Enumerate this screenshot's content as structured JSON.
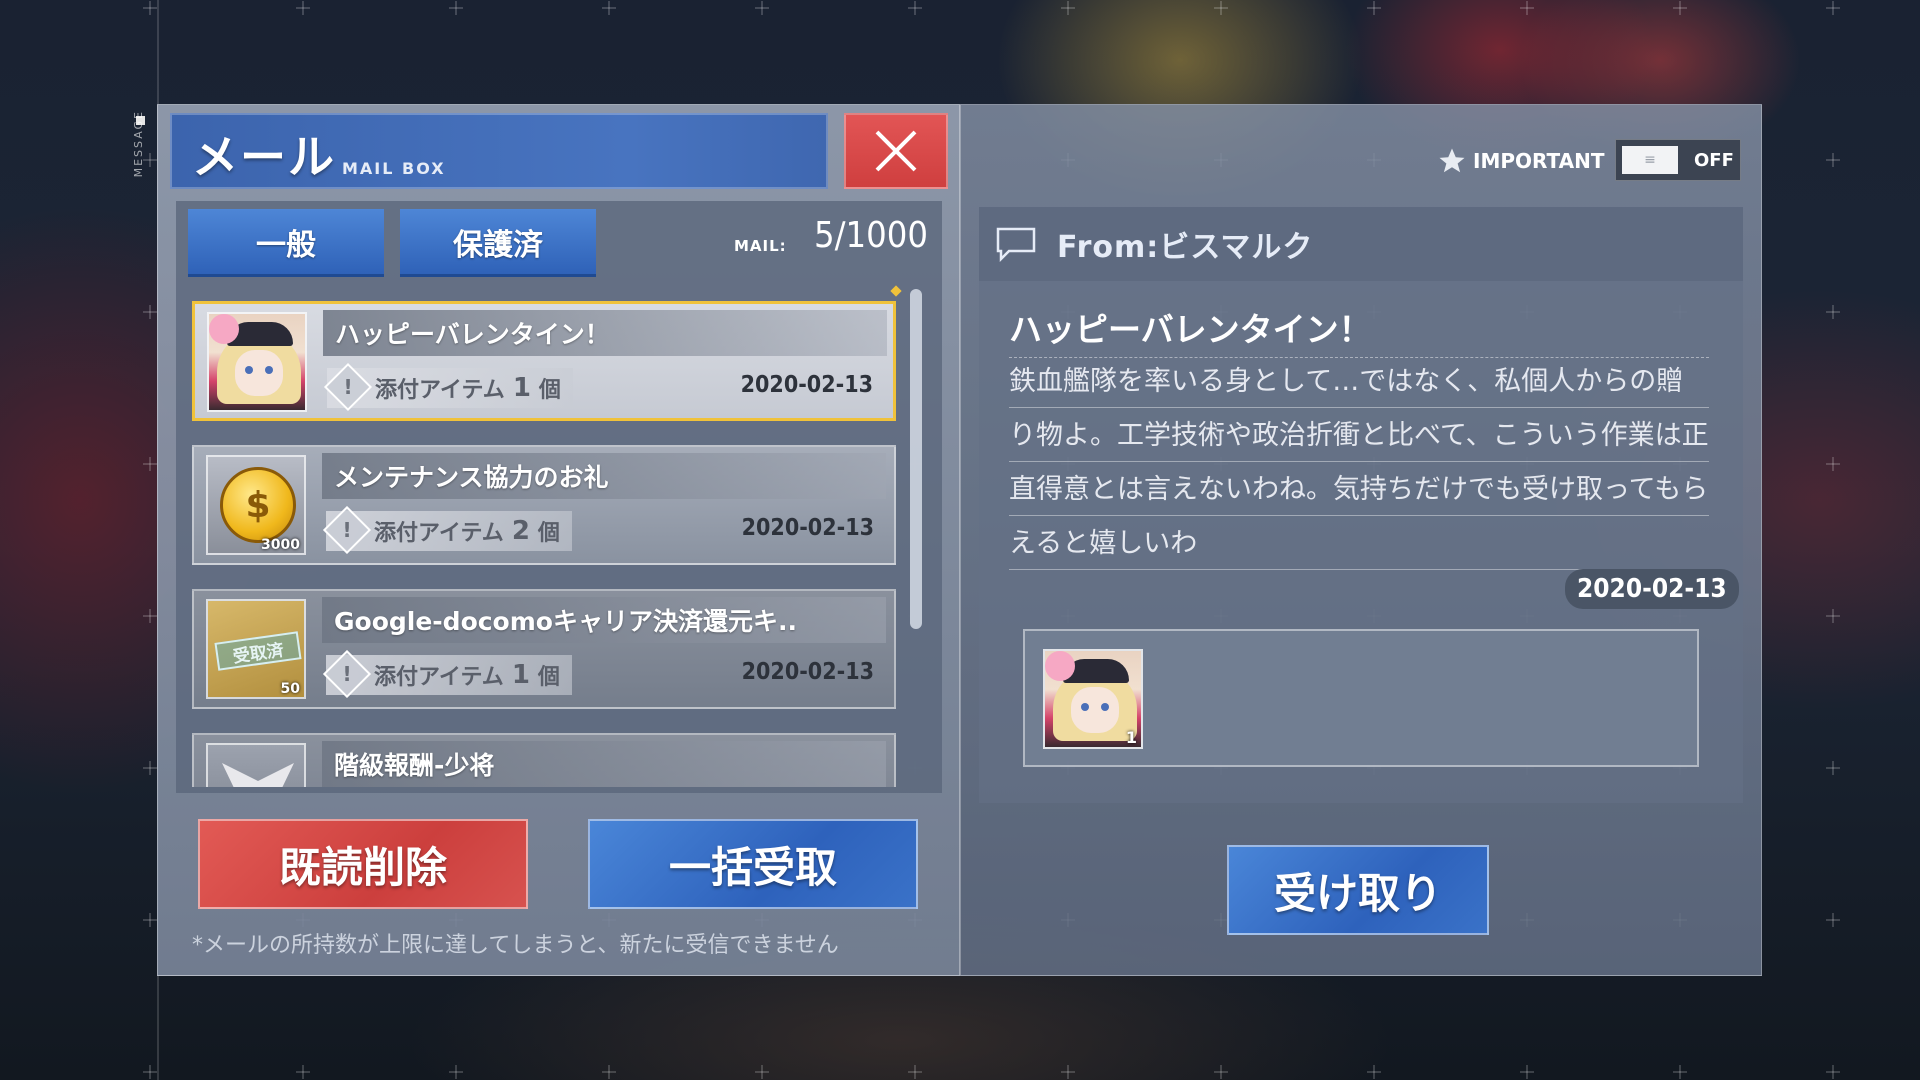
{
  "side_label": "MESSAGE",
  "mailbox": {
    "title_jp": "メール",
    "title_en": "MAIL BOX",
    "tabs": [
      {
        "label": "一般",
        "active": true
      },
      {
        "label": "保護済",
        "active": false
      }
    ],
    "mail_count_label": "MAIL:",
    "mail_count_value": "5/1000",
    "items": [
      {
        "subject": "ハッピーバレンタイン！",
        "attach_label": "添付アイテム",
        "attach_count": "1",
        "attach_unit": "個",
        "date": "2020-02-13",
        "thumb": "portrait-bismarck",
        "selected": true
      },
      {
        "subject": "メンテナンス協力のお礼",
        "attach_label": "添付アイテム",
        "attach_count": "2",
        "attach_unit": "個",
        "date": "2020-02-13",
        "thumb": "coin",
        "thumb_qty": "3000",
        "selected": false
      },
      {
        "subject": "Google-docomoキャリア決済還元キ..",
        "attach_label": "添付アイテム",
        "attach_count": "1",
        "attach_unit": "個",
        "date": "2020-02-13",
        "thumb": "ticket",
        "thumb_stamp": "受取済",
        "thumb_qty": "50",
        "selected": false
      },
      {
        "subject": "階級報酬-少将",
        "thumb": "rank-insignia",
        "selected": false
      }
    ],
    "delete_read_label": "既読削除",
    "collect_all_label": "一括受取",
    "notice": "*メールの所持数が上限に達してしまうと、新たに受信できません"
  },
  "detail": {
    "important_label": "IMPORTANT",
    "toggle_state": "OFF",
    "from_label": "From:ビスマルク",
    "title": "ハッピーバレンタイン！",
    "body": "鉄血艦隊を率いる身として…ではなく、私個人からの贈り物よ。工学技術や政治折衝と比べて、こういう作業は正直得意とは言えないわね。気持ちだけでも受け取ってもらえると嬉しいわ",
    "date": "2020-02-13",
    "attachment_qty": "1",
    "receive_label": "受け取り"
  },
  "colors": {
    "accent_blue": "#3a6fc4",
    "danger_red": "#d7524f",
    "selected_gold": "#f0c23a"
  }
}
